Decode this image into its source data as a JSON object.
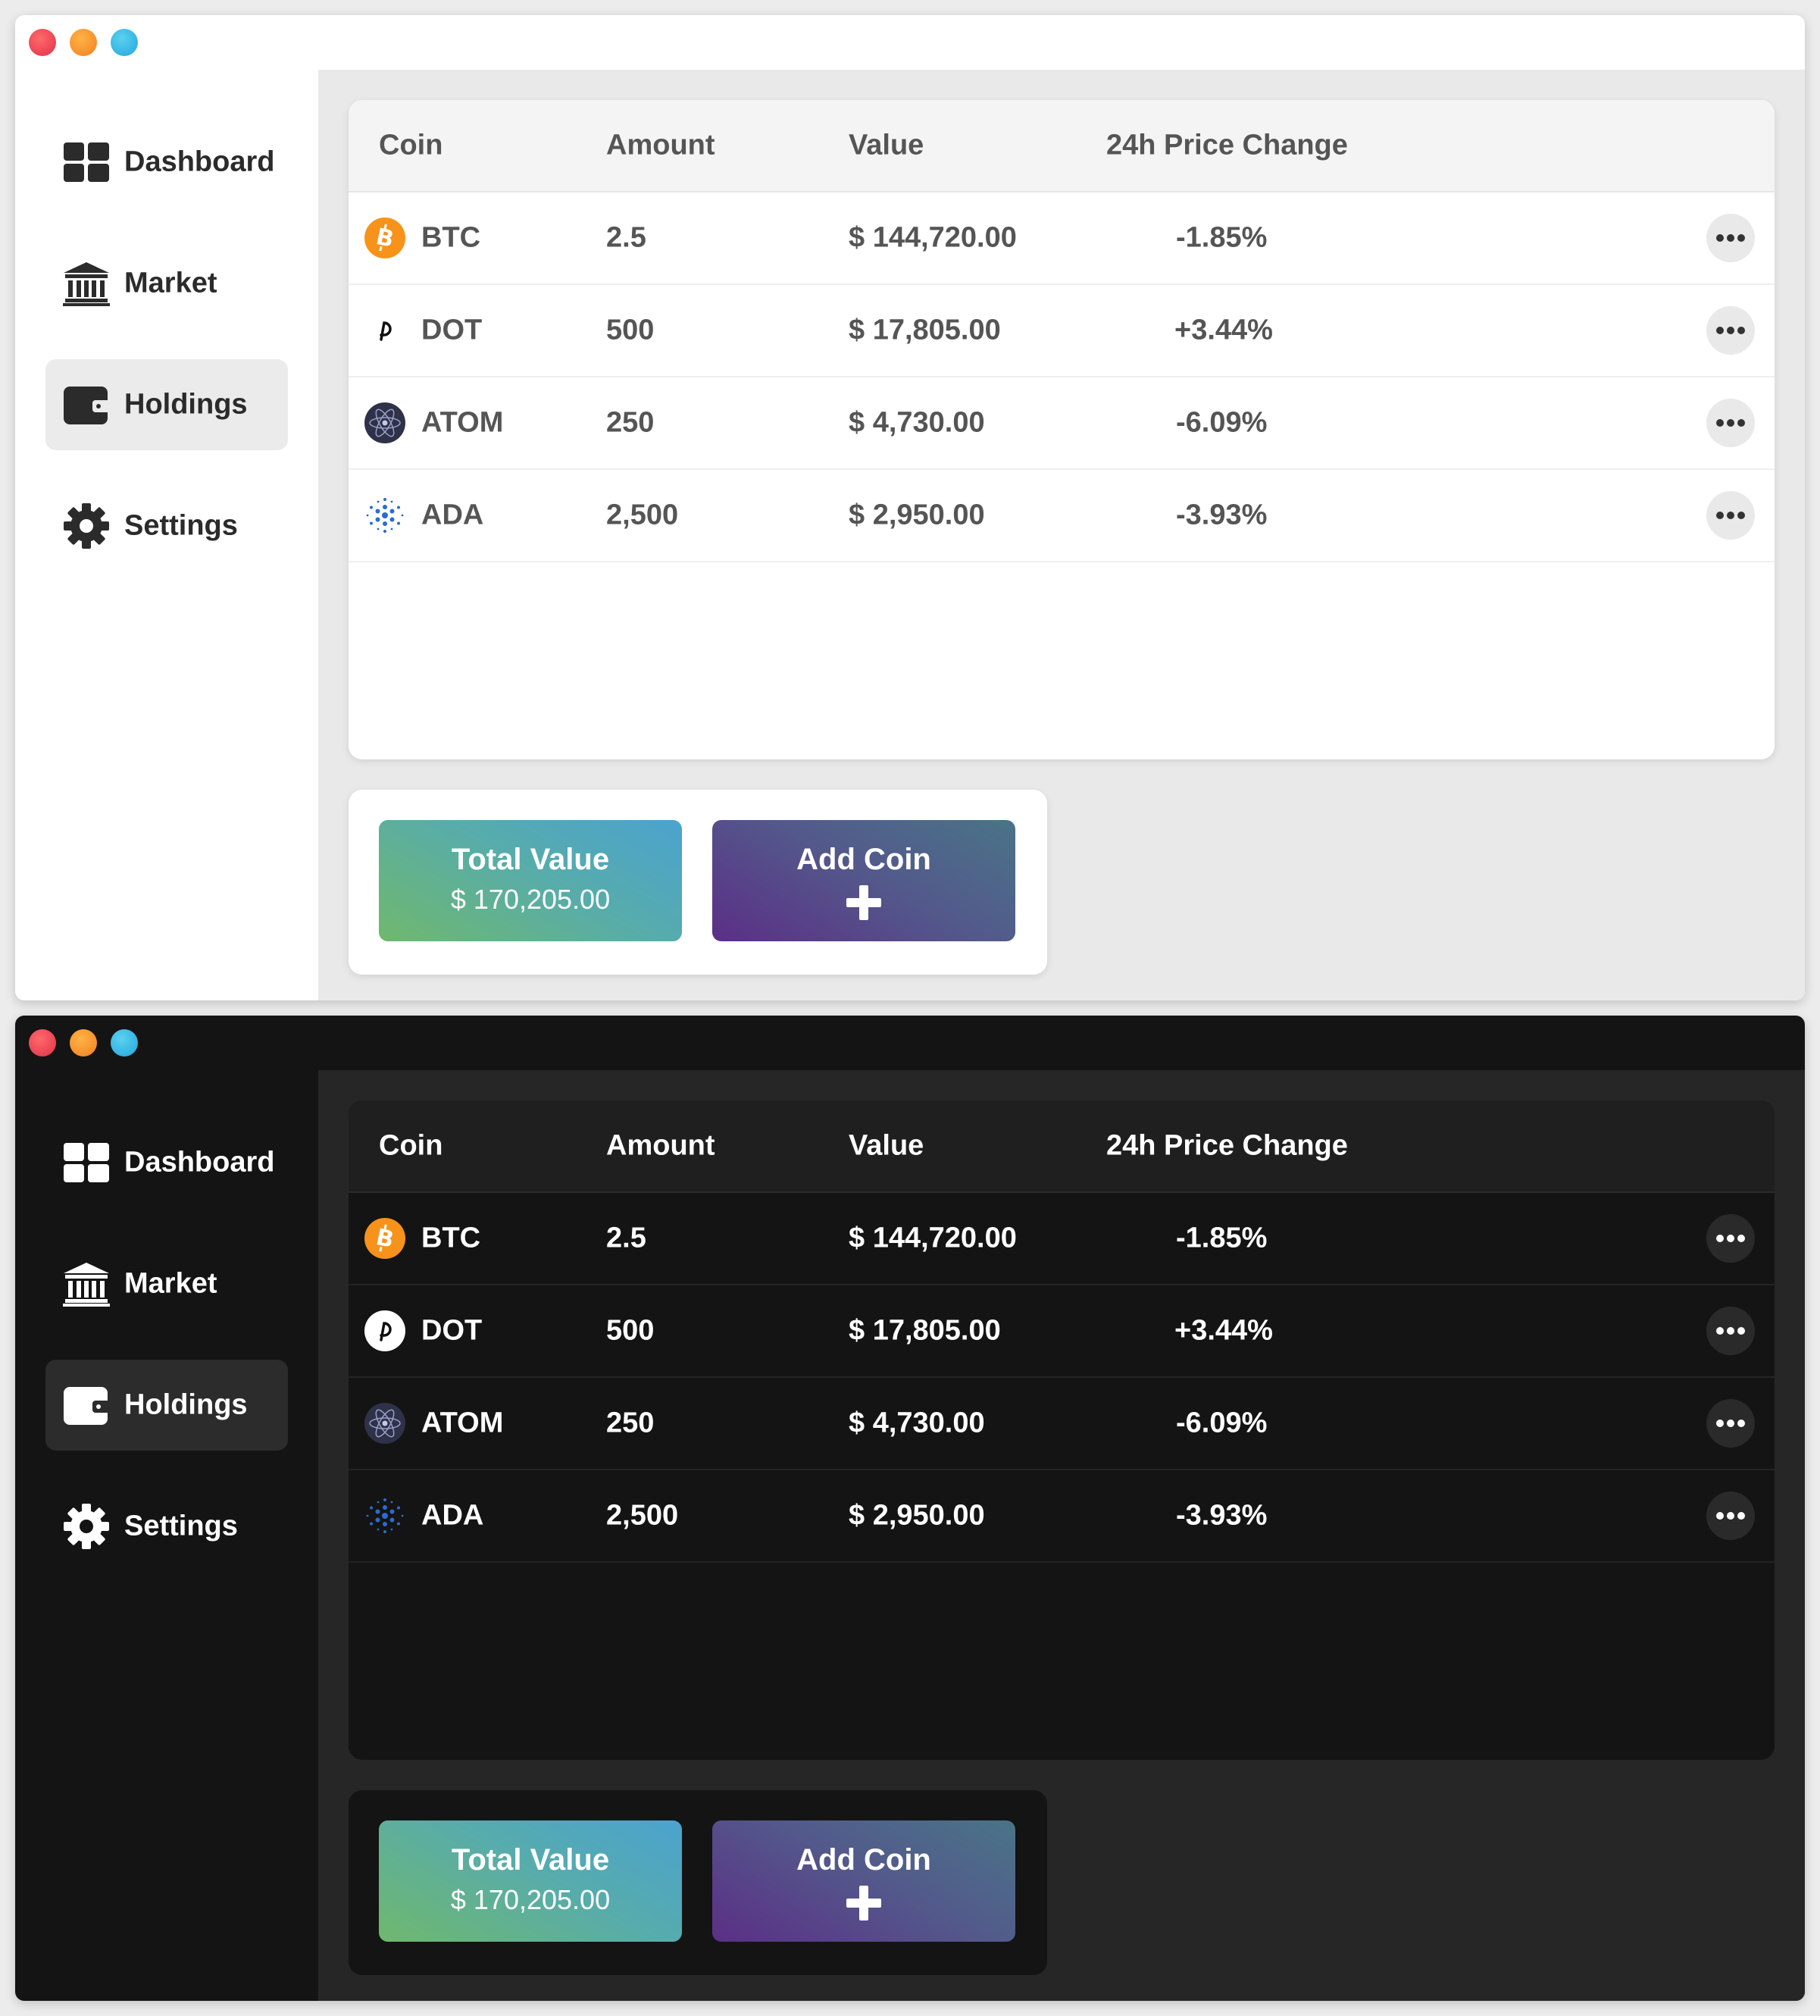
{
  "themes": [
    {
      "id": "light",
      "sidebar": {
        "items": [
          {
            "label": "Dashboard",
            "icon": "dashboard-icon",
            "active": false
          },
          {
            "label": "Market",
            "icon": "bank-icon",
            "active": false
          },
          {
            "label": "Holdings",
            "icon": "wallet-icon",
            "active": true
          },
          {
            "label": "Settings",
            "icon": "gear-icon",
            "active": false
          }
        ]
      },
      "table": {
        "headers": {
          "coin": "Coin",
          "amount": "Amount",
          "value": "Value",
          "change": "24h Price Change"
        },
        "rows": [
          {
            "coin": "BTC",
            "icon": "bitcoin-icon",
            "amount": "2.5",
            "value": "$ 144,720.00",
            "change": "-1.85%"
          },
          {
            "coin": "DOT",
            "icon": "polkadot-icon",
            "amount": "500",
            "value": "$ 17,805.00",
            "change": "+3.44%"
          },
          {
            "coin": "ATOM",
            "icon": "cosmos-icon",
            "amount": "250",
            "value": "$ 4,730.00",
            "change": "-6.09%"
          },
          {
            "coin": "ADA",
            "icon": "cardano-icon",
            "amount": "2,500",
            "value": "$ 2,950.00",
            "change": "-3.93%"
          }
        ]
      },
      "summary": {
        "total_label": "Total Value",
        "total_value": "$ 170,205.00",
        "add_label": "Add Coin"
      }
    },
    {
      "id": "dark",
      "sidebar": {
        "items": [
          {
            "label": "Dashboard",
            "icon": "dashboard-icon",
            "active": false
          },
          {
            "label": "Market",
            "icon": "bank-icon",
            "active": false
          },
          {
            "label": "Holdings",
            "icon": "wallet-icon",
            "active": true
          },
          {
            "label": "Settings",
            "icon": "gear-icon",
            "active": false
          }
        ]
      },
      "table": {
        "headers": {
          "coin": "Coin",
          "amount": "Amount",
          "value": "Value",
          "change": "24h Price Change"
        },
        "rows": [
          {
            "coin": "BTC",
            "icon": "bitcoin-icon",
            "amount": "2.5",
            "value": "$ 144,720.00",
            "change": "-1.85%"
          },
          {
            "coin": "DOT",
            "icon": "polkadot-icon",
            "amount": "500",
            "value": "$ 17,805.00",
            "change": "+3.44%"
          },
          {
            "coin": "ATOM",
            "icon": "cosmos-icon",
            "amount": "250",
            "value": "$ 4,730.00",
            "change": "-6.09%"
          },
          {
            "coin": "ADA",
            "icon": "cardano-icon",
            "amount": "2,500",
            "value": "$ 2,950.00",
            "change": "-3.93%"
          }
        ]
      },
      "summary": {
        "total_label": "Total Value",
        "total_value": "$ 170,205.00",
        "add_label": "Add Coin"
      }
    }
  ],
  "colors": {
    "bitcoin": "#f7931a",
    "cosmos": "#2e3148",
    "cardano": "#2a6bd1",
    "total_gradient": [
      "#6fb86e",
      "#4ba3cf"
    ],
    "add_gradient": [
      "#5b2f86",
      "#497487"
    ]
  }
}
